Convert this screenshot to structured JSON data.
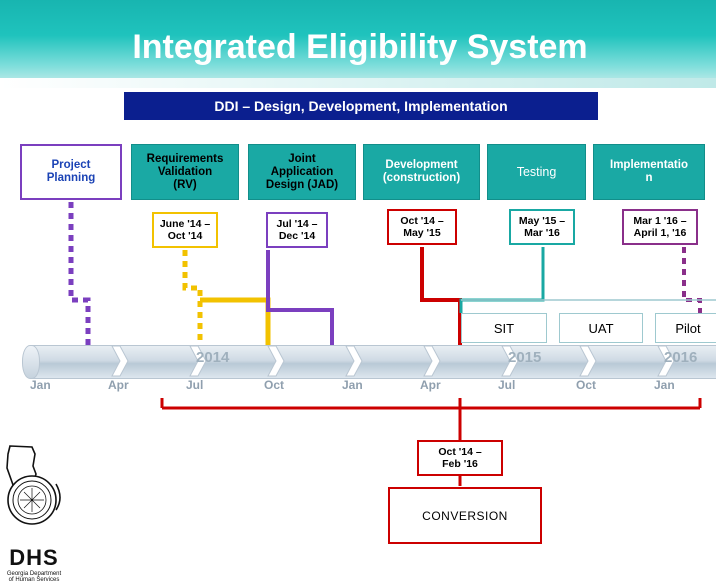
{
  "header": {
    "title": "Integrated Eligibility System",
    "subtitle": "DDI – Design, Development, Implementation"
  },
  "phases": [
    {
      "label": "Project Planning",
      "date": "",
      "accent": "#7b3fbf"
    },
    {
      "label": "Requirements Validation (RV)",
      "date": "June '14 – Oct '14",
      "accent": "#f2c200"
    },
    {
      "label": "Joint Application Design (JAD)",
      "date": "Jul '14 – Dec '14",
      "accent": "#7b3fbf"
    },
    {
      "label": "Development (construction)",
      "date": "Oct '14 – May '15",
      "accent": "#cc0000"
    },
    {
      "label": "Testing",
      "date": "May '15 – Mar '16",
      "accent": "#19a8a3"
    },
    {
      "label": "Implementation",
      "date": "Mar 1 '16 – April 1, '16",
      "accent": "#8a2f8a"
    }
  ],
  "phase_labels": {
    "p0_line1": "Project",
    "p0_line2": "Planning",
    "p1_line1": "Requirements",
    "p1_line2": "Validation",
    "p1_line3": "(RV)",
    "p2_line1": "Joint",
    "p2_line2": "Application",
    "p2_line3": "Design (JAD)",
    "p3_line1": "Development",
    "p3_line2": "(construction)",
    "p4_line1": "Testing",
    "p5_line1": "Implementatio",
    "p5_line2": "n"
  },
  "dates": {
    "d1_line1": "June '14 –",
    "d1_line2": "Oct '14",
    "d2_line1": "Jul '14 –",
    "d2_line2": "Dec '14",
    "d3_line1": "Oct '14 –",
    "d3_line2": "May '15",
    "d4_line1": "May '15 –",
    "d4_line2": "Mar '16",
    "d5_line1": "Mar 1 '16 –",
    "d5_line2": "April 1, '16",
    "d6_line1": "Oct '14 –",
    "d6_line2": "Feb '16"
  },
  "test_phases": [
    {
      "label": "SIT"
    },
    {
      "label": "UAT"
    },
    {
      "label": "Pilot"
    }
  ],
  "timeline": {
    "years": [
      "2014",
      "2015",
      "2016"
    ],
    "months": [
      "Jan",
      "Apr",
      "Jul",
      "Oct",
      "Jan",
      "Apr",
      "Jul",
      "Oct",
      "Jan"
    ]
  },
  "conversion": {
    "label": "CONVERSION"
  },
  "logo": {
    "state_outline": "georgia-outline",
    "seal": "dhs-seal",
    "acronym": "DHS",
    "line1": "Georgia Department",
    "line2": "of Human Services"
  },
  "colors": {
    "teal": "#1aa9a4",
    "header_teal": "#18b5b0",
    "navy": "#0b1f8f",
    "purple": "#7b3fbf",
    "yellow": "#f2c200",
    "red": "#cc0000",
    "magenta": "#8a2f8a"
  }
}
